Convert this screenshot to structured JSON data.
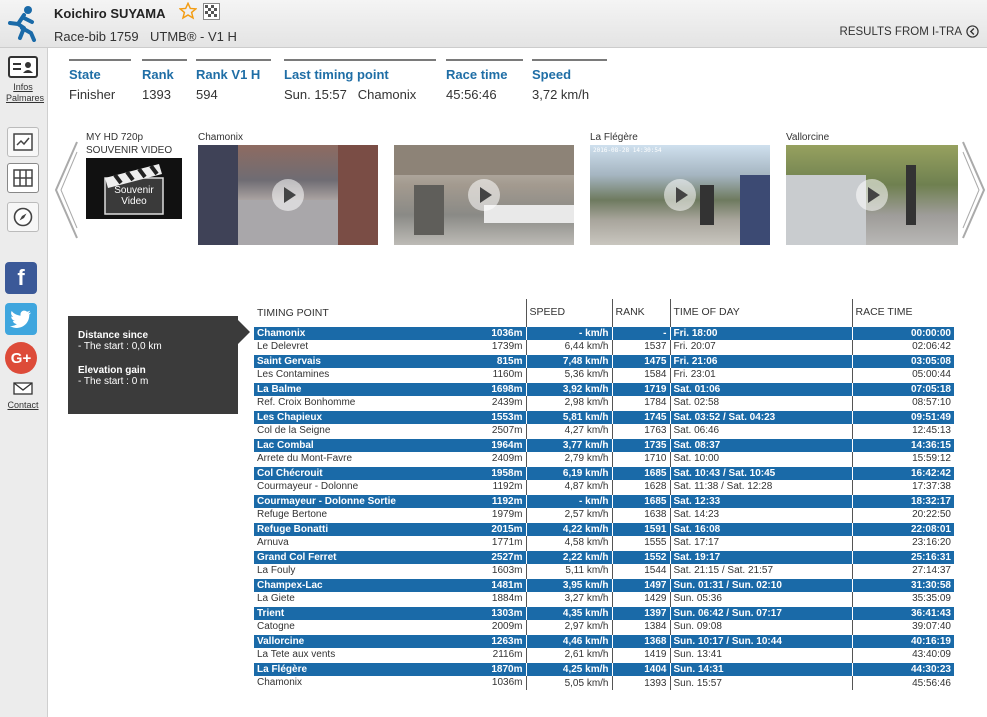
{
  "header": {
    "runner_name": "Koichiro SUYAMA",
    "bib": "Race-bib 1759",
    "race": "UTMB® - V1 H",
    "itra_link": "RESULTS FROM I-TRA"
  },
  "sidebar": {
    "infos_label": "Infos",
    "palmares_label": "Palmares",
    "contact_label": "Contact"
  },
  "stats": [
    {
      "label": "State",
      "value": "Finisher"
    },
    {
      "label": "Rank",
      "value": "1393"
    },
    {
      "label": "Rank V1 H",
      "value": "594"
    },
    {
      "label": "Last timing point",
      "value": "Sun. 15:57   Chamonix"
    },
    {
      "label": "Race time",
      "value": "45:56:46"
    },
    {
      "label": "Speed",
      "value": "3,72 km/h"
    }
  ],
  "videos": {
    "souvenir_caption_1": "MY HD 720p",
    "souvenir_caption_2": "SOUVENIR VIDEO",
    "souvenir_thumb_text_1": "Souvenir",
    "souvenir_thumb_text_2": "Video",
    "cam1_caption": "Chamonix",
    "cam2_caption": "",
    "cam3_caption": "La Flégère",
    "cam4_caption": "Vallorcine",
    "cam3_stamp": "2016-08-28 14:30:54"
  },
  "info_box": {
    "distance_title": "Distance since",
    "distance_value": "- The start : 0,0 km",
    "elevation_title": "Elevation gain",
    "elevation_value": "- The start : 0 m"
  },
  "table": {
    "headers": [
      "TIMING POINT",
      "SPEED",
      "RANK",
      "TIME OF DAY",
      "RACE TIME"
    ],
    "rows": [
      {
        "point": "Chamonix",
        "alt": "1036m",
        "speed": "- km/h",
        "rank": "-",
        "tod": "Fri. 18:00",
        "time": "00:00:00",
        "hl": true
      },
      {
        "point": "Le Delevret",
        "alt": "1739m",
        "speed": "6,44 km/h",
        "rank": "1537",
        "tod": "Fri. 20:07",
        "time": "02:06:42",
        "hl": false
      },
      {
        "point": "Saint Gervais",
        "alt": "815m",
        "speed": "7,48 km/h",
        "rank": "1475",
        "tod": "Fri. 21:06",
        "time": "03:05:08",
        "hl": true
      },
      {
        "point": "Les Contamines",
        "alt": "1160m",
        "speed": "5,36 km/h",
        "rank": "1584",
        "tod": "Fri. 23:01",
        "time": "05:00:44",
        "hl": false
      },
      {
        "point": "La Balme",
        "alt": "1698m",
        "speed": "3,92 km/h",
        "rank": "1719",
        "tod": "Sat. 01:06",
        "time": "07:05:18",
        "hl": true
      },
      {
        "point": "Ref. Croix Bonhomme",
        "alt": "2439m",
        "speed": "2,98 km/h",
        "rank": "1784",
        "tod": "Sat. 02:58",
        "time": "08:57:10",
        "hl": false
      },
      {
        "point": "Les Chapieux",
        "alt": "1553m",
        "speed": "5,81 km/h",
        "rank": "1745",
        "tod": "Sat. 03:52 / Sat. 04:23",
        "time": "09:51:49",
        "hl": true
      },
      {
        "point": "Col de la Seigne",
        "alt": "2507m",
        "speed": "4,27 km/h",
        "rank": "1763",
        "tod": "Sat. 06:46",
        "time": "12:45:13",
        "hl": false
      },
      {
        "point": "Lac Combal",
        "alt": "1964m",
        "speed": "3,77 km/h",
        "rank": "1735",
        "tod": "Sat. 08:37",
        "time": "14:36:15",
        "hl": true
      },
      {
        "point": "Arrete du Mont-Favre",
        "alt": "2409m",
        "speed": "2,79 km/h",
        "rank": "1710",
        "tod": "Sat. 10:00",
        "time": "15:59:12",
        "hl": false
      },
      {
        "point": "Col Chécrouit",
        "alt": "1958m",
        "speed": "6,19 km/h",
        "rank": "1685",
        "tod": "Sat. 10:43 / Sat. 10:45",
        "time": "16:42:42",
        "hl": true
      },
      {
        "point": "Courmayeur - Dolonne",
        "alt": "1192m",
        "speed": "4,87 km/h",
        "rank": "1628",
        "tod": "Sat. 11:38 / Sat. 12:28",
        "time": "17:37:38",
        "hl": false
      },
      {
        "point": "Courmayeur - Dolonne Sortie",
        "alt": "1192m",
        "speed": "- km/h",
        "rank": "1685",
        "tod": "Sat. 12:33",
        "time": "18:32:17",
        "hl": true
      },
      {
        "point": "Refuge Bertone",
        "alt": "1979m",
        "speed": "2,57 km/h",
        "rank": "1638",
        "tod": "Sat. 14:23",
        "time": "20:22:50",
        "hl": false
      },
      {
        "point": "Refuge Bonatti",
        "alt": "2015m",
        "speed": "4,22 km/h",
        "rank": "1591",
        "tod": "Sat. 16:08",
        "time": "22:08:01",
        "hl": true
      },
      {
        "point": "Arnuva",
        "alt": "1771m",
        "speed": "4,58 km/h",
        "rank": "1555",
        "tod": "Sat. 17:17",
        "time": "23:16:20",
        "hl": false
      },
      {
        "point": "Grand Col Ferret",
        "alt": "2527m",
        "speed": "2,22 km/h",
        "rank": "1552",
        "tod": "Sat. 19:17",
        "time": "25:16:31",
        "hl": true
      },
      {
        "point": "La Fouly",
        "alt": "1603m",
        "speed": "5,11 km/h",
        "rank": "1544",
        "tod": "Sat. 21:15 / Sat. 21:57",
        "time": "27:14:37",
        "hl": false
      },
      {
        "point": "Champex-Lac",
        "alt": "1481m",
        "speed": "3,95 km/h",
        "rank": "1497",
        "tod": "Sun. 01:31 / Sun. 02:10",
        "time": "31:30:58",
        "hl": true
      },
      {
        "point": "La Giete",
        "alt": "1884m",
        "speed": "3,27 km/h",
        "rank": "1429",
        "tod": "Sun. 05:36",
        "time": "35:35:09",
        "hl": false
      },
      {
        "point": "Trient",
        "alt": "1303m",
        "speed": "4,35 km/h",
        "rank": "1397",
        "tod": "Sun. 06:42 / Sun. 07:17",
        "time": "36:41:43",
        "hl": true
      },
      {
        "point": "Catogne",
        "alt": "2009m",
        "speed": "2,97 km/h",
        "rank": "1384",
        "tod": "Sun. 09:08",
        "time": "39:07:40",
        "hl": false
      },
      {
        "point": "Vallorcine",
        "alt": "1263m",
        "speed": "4,46 km/h",
        "rank": "1368",
        "tod": "Sun. 10:17 / Sun. 10:44",
        "time": "40:16:19",
        "hl": true
      },
      {
        "point": "La Tete aux vents",
        "alt": "2116m",
        "speed": "2,61 km/h",
        "rank": "1419",
        "tod": "Sun. 13:41",
        "time": "43:40:09",
        "hl": false
      },
      {
        "point": "La Flégère",
        "alt": "1870m",
        "speed": "4,25 km/h",
        "rank": "1404",
        "tod": "Sun. 14:31",
        "time": "44:30:23",
        "hl": true
      },
      {
        "point": "Chamonix",
        "alt": "1036m",
        "speed": "5,05 km/h",
        "rank": "1393",
        "tod": "Sun. 15:57",
        "time": "45:56:46",
        "hl": false
      }
    ]
  },
  "colors": {
    "accent": "#1a6aa8",
    "stat_label": "#1f6ea6",
    "facebook": "#3b5998",
    "twitter": "#3fa6de",
    "google": "#dd4b39"
  }
}
